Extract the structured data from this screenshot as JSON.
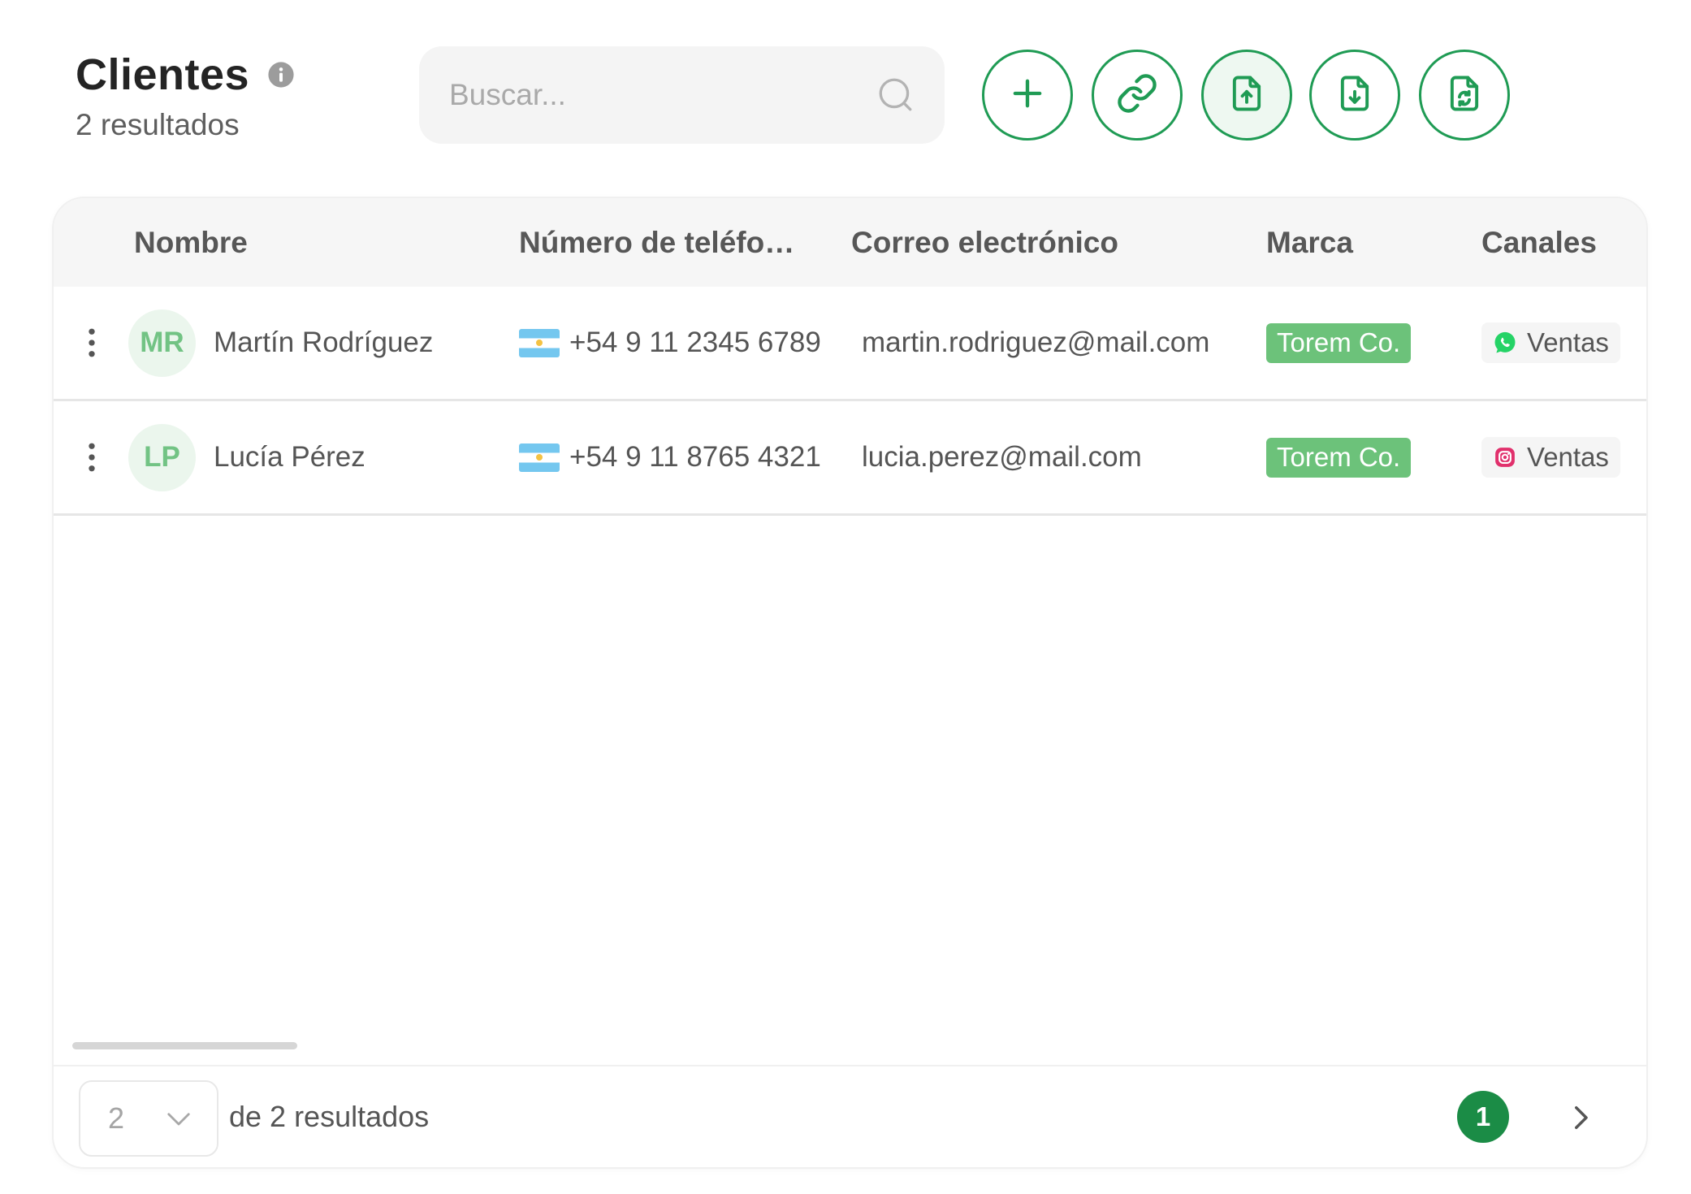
{
  "header": {
    "title": "Clientes",
    "subtitle": "2 resultados",
    "info_icon": "info-icon"
  },
  "search": {
    "placeholder": "Buscar...",
    "icon": "search-icon"
  },
  "toolbar": {
    "buttons": [
      {
        "icon": "plus-icon"
      },
      {
        "icon": "link-icon"
      },
      {
        "icon": "file-upload-icon"
      },
      {
        "icon": "file-download-icon"
      },
      {
        "icon": "file-sync-icon"
      }
    ]
  },
  "table": {
    "columns": [
      "Nombre",
      "Número de teléfo…",
      "Correo electrónico",
      "Marca",
      "Canales"
    ],
    "rows": [
      {
        "initials": "MR",
        "name": "Martín Rodríguez",
        "flag_icon": "argentina-flag-icon",
        "phone": "+54 9 11 2345 6789",
        "email": "martin.rodriguez@mail.com",
        "brand": "Torem Co.",
        "channel": {
          "icon": "whatsapp-icon",
          "label": "Ventas"
        }
      },
      {
        "initials": "LP",
        "name": "Lucía Pérez",
        "flag_icon": "argentina-flag-icon",
        "phone": "+54 9 11 8765 4321",
        "email": "lucia.perez@mail.com",
        "brand": "Torem Co.",
        "channel": {
          "icon": "instagram-icon",
          "label": "Ventas"
        }
      }
    ]
  },
  "footer": {
    "page_size": "2",
    "results_text": "de 2 resultados",
    "current_page": "1",
    "next_icon": "chevron-right-icon"
  },
  "colors": {
    "accent": "#1f9b54",
    "brand-badge": "#6cc27a",
    "avatar-bg": "#ebf6ed",
    "avatar-text": "#72c384",
    "header-bg": "#f6f6f6",
    "page-active": "#1b8c46"
  }
}
